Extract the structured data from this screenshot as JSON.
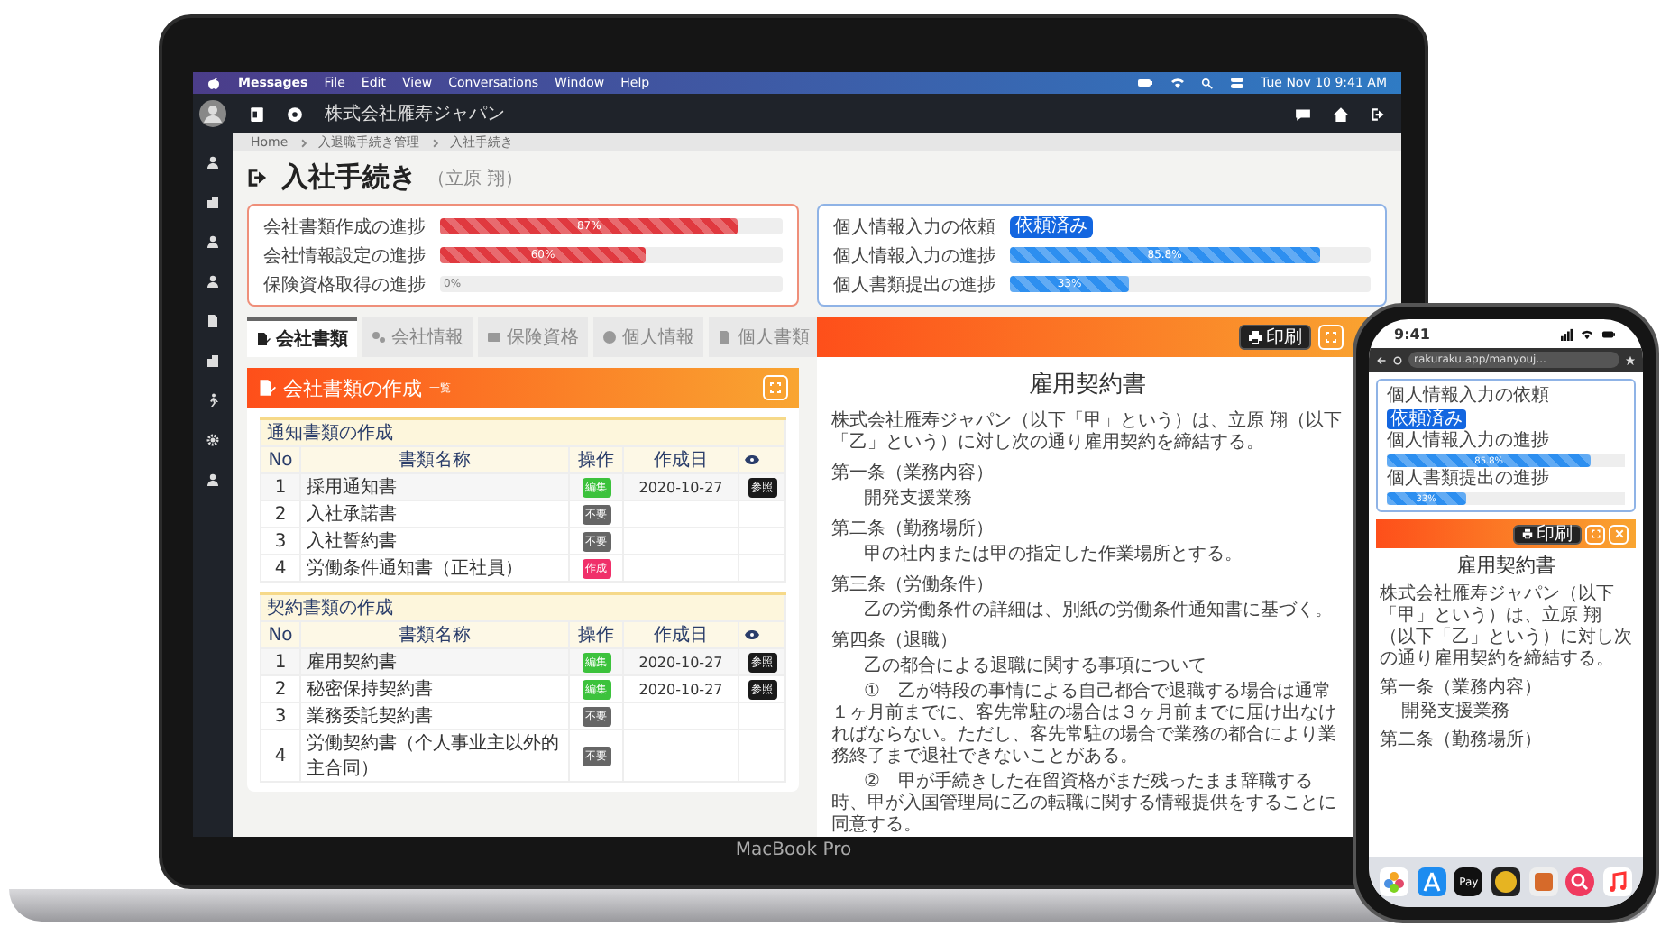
{
  "menubar": {
    "app": "Messages",
    "menus": [
      "File",
      "Edit",
      "View",
      "Conversations",
      "Window",
      "Help"
    ],
    "clock": "Tue Nov 10  9:41 AM"
  },
  "header": {
    "company": "株式会社雁寿ジャパン"
  },
  "breadcrumb": [
    "Home",
    "入退職手続き管理",
    "入社手続き"
  ],
  "page": {
    "title": "入社手続き",
    "person": "（立原 翔）"
  },
  "progress_cards": [
    {
      "kind": "company",
      "rows": [
        {
          "kind": "bar",
          "label": "会社書類作成の進捗",
          "level": 0.87,
          "reading": "87%"
        },
        {
          "kind": "bar",
          "label": "会社情報設定の進捗",
          "level": 0.6,
          "reading": "60%"
        },
        {
          "kind": "bar",
          "label": "保険資格取得の進捗",
          "level": 0,
          "reading": "0%"
        }
      ]
    },
    {
      "kind": "personal",
      "rows": [
        {
          "kind": "badge",
          "label": "個人情報入力の依頼",
          "badge": "依頼済み"
        },
        {
          "kind": "bar",
          "label": "個人情報入力の進捗",
          "level": 0.858,
          "reading": "85.8%"
        },
        {
          "kind": "bar",
          "label": "個人書類提出の進捗",
          "level": 0.33,
          "reading": "33%"
        }
      ]
    }
  ],
  "tabs": [
    {
      "label": "会社書類",
      "selected": true
    },
    {
      "label": "会社情報",
      "selected": false
    },
    {
      "label": "保険資格",
      "selected": false
    },
    {
      "label": "個人情報",
      "selected": false
    },
    {
      "label": "個人書類",
      "selected": false
    }
  ],
  "panel": {
    "title": "会社書類の作成",
    "subtitle": "一覧"
  },
  "tables": [
    {
      "section": "通知書類の作成",
      "columns": [
        "No",
        "書類名称",
        "操作",
        "作成日"
      ],
      "rows": [
        {
          "no": "1",
          "name": "採用通知書",
          "action": {
            "kind": "edit",
            "label": "編集"
          },
          "date": "2020-10-27",
          "view": "参照"
        },
        {
          "no": "2",
          "name": "入社承諾書",
          "action": {
            "kind": "unneeded",
            "label": "不要"
          }
        },
        {
          "no": "3",
          "name": "入社誓約書",
          "action": {
            "kind": "unneeded",
            "label": "不要"
          }
        },
        {
          "no": "4",
          "name": "労働条件通知書（正社員）",
          "action": {
            "kind": "create",
            "label": "作成"
          }
        }
      ]
    },
    {
      "section": "契約書類の作成",
      "columns": [
        "No",
        "書類名称",
        "操作",
        "作成日"
      ],
      "rows": [
        {
          "no": "1",
          "name": "雇用契約書",
          "action": {
            "kind": "edit",
            "label": "編集"
          },
          "date": "2020-10-27",
          "view": "参照"
        },
        {
          "no": "2",
          "name": "秘密保持契約書",
          "action": {
            "kind": "edit",
            "label": "編集"
          },
          "date": "2020-10-27",
          "view": "参照"
        },
        {
          "no": "3",
          "name": "業務委託契約書",
          "action": {
            "kind": "unneeded",
            "label": "不要"
          }
        },
        {
          "no": "4",
          "name": "労働契約書（个人事业主以外的主合同）",
          "action": {
            "kind": "unneeded",
            "label": "不要"
          }
        }
      ]
    }
  ],
  "document": {
    "print": "印刷",
    "title": "雇用契約書",
    "paragraphs": [
      {
        "kind": "body",
        "text": "株式会社雁寿ジャパン（以下「甲」という）は、立原 翔（以下「乙」という）に対し次の通り雇用契約を締結する。"
      },
      {
        "kind": "heading",
        "text": "第一条（業務内容）"
      },
      {
        "kind": "indent",
        "text": "開発支援業務"
      },
      {
        "kind": "heading",
        "text": "第二条（勤務場所）"
      },
      {
        "kind": "indent",
        "text": "甲の社内または甲の指定した作業場所とする。"
      },
      {
        "kind": "heading",
        "text": "第三条（労働条件）"
      },
      {
        "kind": "indent",
        "text": "乙の労働条件の詳細は、別紙の労働条件通知書に基づく。"
      },
      {
        "kind": "heading",
        "text": "第四条（退職）"
      },
      {
        "kind": "indent",
        "text": "乙の都合による退職に関する事項について"
      },
      {
        "kind": "item",
        "text": "①　乙が特段の事情による自己都合で退職する場合は通常１ヶ月前までに、客先常駐の場合は３ヶ月前までに届け出なければならない。ただし、客先常駐の場合で業務の都合により業務終了まで退社できないことがある。"
      },
      {
        "kind": "item",
        "text": "②　甲が手続きした在留資格がまだ残ったまま辞職する時、甲が入国管理局に乙の転職に関する情報提供をすることに同意する。"
      }
    ]
  },
  "laptop_label": "MacBook Pro",
  "phone": {
    "time": "9:41",
    "url": "rakuraku.app/manyouj...",
    "rows": [
      {
        "kind": "badge",
        "label": "個人情報入力の依頼",
        "badge": "依頼済み"
      },
      {
        "kind": "bar",
        "label": "個人情報入力の進捗",
        "level": 0.858,
        "reading": "85.8%"
      },
      {
        "kind": "bar",
        "label": "個人書類提出の進捗",
        "level": 0.33,
        "reading": "33%"
      }
    ],
    "print": "印刷",
    "doc_title": "雇用契約書",
    "paragraphs": [
      {
        "kind": "body",
        "text": "株式会社雁寿ジャパン（以下「甲」という）は、立原 翔（以下「乙」という）に対し次の通り雇用契約を締結する。"
      },
      {
        "kind": "heading",
        "text": "第一条（業務内容）"
      },
      {
        "kind": "indent",
        "text": "開発支援業務"
      },
      {
        "kind": "heading",
        "text": "第二条（勤務場所）"
      }
    ],
    "pay_label": "Pay"
  }
}
